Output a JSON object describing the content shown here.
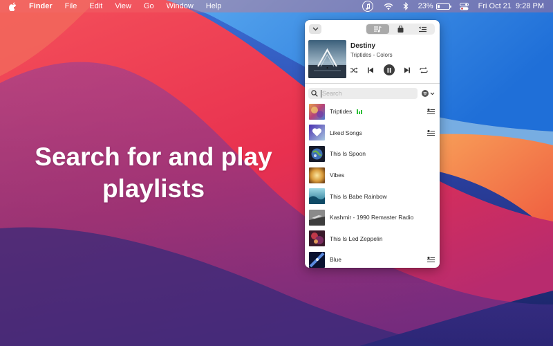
{
  "menubar": {
    "app_name": "Finder",
    "menus": [
      "File",
      "Edit",
      "View",
      "Go",
      "Window",
      "Help"
    ],
    "battery_percent": "23%",
    "battery_level": 0.23,
    "datetime": "Fri Oct 21  9:28 PM"
  },
  "hero": {
    "line1": "Search for and play",
    "line2": "playlists"
  },
  "popover": {
    "now_playing": {
      "title": "Destiny",
      "subtitle": "Triptides - Colors"
    },
    "search": {
      "placeholder": "Search"
    },
    "playlists": [
      {
        "label": "Triptides",
        "playing": true,
        "queue_button": true
      },
      {
        "label": "Liked Songs",
        "playing": false,
        "queue_button": true
      },
      {
        "label": "This Is Spoon",
        "playing": false,
        "queue_button": false
      },
      {
        "label": "Vibes",
        "playing": false,
        "queue_button": false
      },
      {
        "label": "This Is Babe Rainbow",
        "playing": false,
        "queue_button": false
      },
      {
        "label": "Kashmir - 1990 Remaster Radio",
        "playing": false,
        "queue_button": false
      },
      {
        "label": "This Is Led Zeppelin",
        "playing": false,
        "queue_button": false
      },
      {
        "label": "Blue",
        "playing": false,
        "queue_button": true
      }
    ]
  },
  "icons": {
    "menubar": [
      "apple-icon",
      "music-status-icon",
      "wifi-icon",
      "bluetooth-icon",
      "battery-icon",
      "control-center-icon"
    ],
    "popover": [
      "chevron-down-icon",
      "queue-tab-icon",
      "library-tab-icon",
      "playlists-tab-icon",
      "shuffle-icon",
      "previous-icon",
      "pause-icon",
      "next-icon",
      "repeat-icon",
      "search-icon",
      "source-icon",
      "add-to-queue-icon"
    ]
  },
  "colors": {
    "playing_indicator": "#2fbf3a",
    "popover_bg": "#ffffff"
  }
}
